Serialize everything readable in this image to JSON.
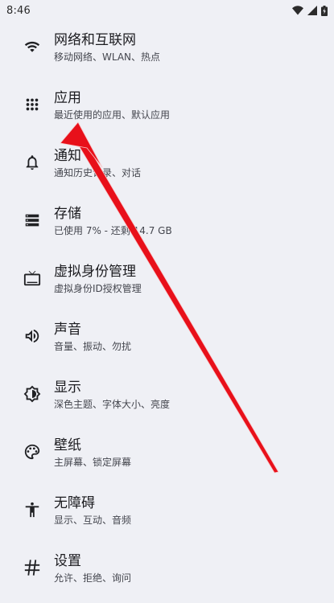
{
  "status_bar": {
    "time": "8:46"
  },
  "settings": {
    "items": [
      {
        "icon": "wifi-icon",
        "title": "网络和互联网",
        "subtitle": "移动网络、WLAN、热点"
      },
      {
        "icon": "apps-icon",
        "title": "应用",
        "subtitle": "最近使用的应用、默认应用"
      },
      {
        "icon": "bell-icon",
        "title": "通知",
        "subtitle": "通知历史记录、对话"
      },
      {
        "icon": "storage-icon",
        "title": "存储",
        "subtitle": "已使用 7% - 还剩 14.7 GB"
      },
      {
        "icon": "tv-icon",
        "title": "虚拟身份管理",
        "subtitle": "虚拟身份ID授权管理"
      },
      {
        "icon": "speaker-icon",
        "title": "声音",
        "subtitle": "音量、振动、勿扰"
      },
      {
        "icon": "brightness-icon",
        "title": "显示",
        "subtitle": "深色主题、字体大小、亮度"
      },
      {
        "icon": "palette-icon",
        "title": "壁纸",
        "subtitle": "主屏幕、锁定屏幕"
      },
      {
        "icon": "accessibility-icon",
        "title": "无障碍",
        "subtitle": "显示、互动、音频"
      },
      {
        "icon": "hash-icon",
        "title": "设置",
        "subtitle": "允许、拒绝、询问"
      }
    ]
  },
  "annotation": {
    "color": "#e8101a"
  }
}
